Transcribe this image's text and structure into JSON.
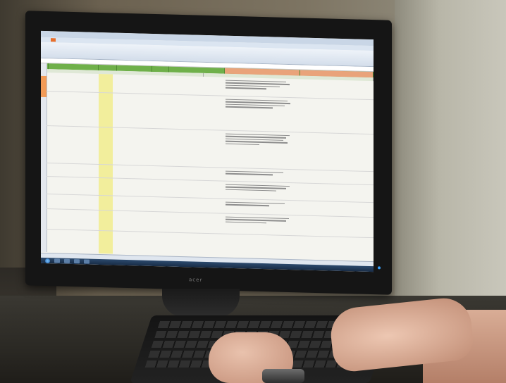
{
  "scene": {
    "monitor_brand": "acer",
    "spreadsheet": {
      "ribbon_tabs": [
        "",
        "",
        "",
        "",
        "",
        "",
        "",
        ""
      ],
      "rows": [
        {
          "label": "",
          "text": ""
        },
        {
          "label": "",
          "text": ""
        },
        {
          "label": "",
          "text": ""
        },
        {
          "label": "",
          "text": ""
        },
        {
          "label": "",
          "text": ""
        },
        {
          "label": "",
          "text": ""
        },
        {
          "label": "",
          "text": ""
        }
      ]
    },
    "colors": {
      "header_green": "#6fb04a",
      "highlight_yellow": "#f2ee9c",
      "office_tab_orange": "#e86f2b",
      "taskbar_blue": "#2c4a6e"
    }
  }
}
